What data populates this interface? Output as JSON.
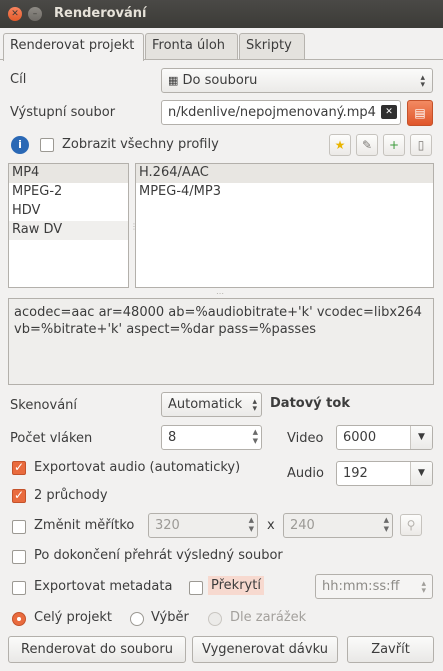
{
  "window": {
    "title": "Renderování"
  },
  "tabs": [
    {
      "label": "Renderovat projekt",
      "active": true
    },
    {
      "label": "Fronta úloh"
    },
    {
      "label": "Skripty"
    }
  ],
  "target": {
    "label": "Cíl",
    "value": "Do souboru"
  },
  "output_file": {
    "label": "Výstupní soubor",
    "value": "n/kdenlive/nepojmenovaný.mp4"
  },
  "show_all_profiles": {
    "label": "Zobrazit všechny profily",
    "checked": false
  },
  "formats": [
    "MP4",
    "MPEG-2",
    "HDV",
    "Raw DV"
  ],
  "codecs": [
    "H.264/AAC",
    "MPEG-4/MP3"
  ],
  "params_text": "acodec=aac ar=48000 ab=%audiobitrate+'k' vcodec=libx264 vb=%bitrate+'k' aspect=%dar pass=%passes",
  "scanning": {
    "label": "Skenování",
    "value": "Automatick"
  },
  "bitrate": {
    "heading": "Datový tok",
    "video_label": "Video",
    "video_value": "6000",
    "audio_label": "Audio",
    "audio_value": "192"
  },
  "threads": {
    "label": "Počet vláken",
    "value": "8"
  },
  "export_audio": {
    "label": "Exportovat audio (automaticky)",
    "checked": true
  },
  "two_pass": {
    "label": "2 průchody",
    "checked": true
  },
  "rescale": {
    "label": "Změnit měřítko",
    "checked": false,
    "width": "320",
    "x": "x",
    "height": "240"
  },
  "play_after": {
    "label": "Po dokončení přehrát výsledný soubor",
    "checked": false
  },
  "export_metadata": {
    "label": "Exportovat metadata",
    "checked": false
  },
  "overlay": {
    "label": "Překrytí",
    "checked": false,
    "timecode": "hh:mm:ss:ff"
  },
  "range": {
    "whole": "Celý projekt",
    "selection": "Výběr",
    "guides": "Dle zarážek",
    "selected": "whole"
  },
  "buttons": {
    "render": "Renderovat do souboru",
    "batch": "Vygenerovat dávku",
    "close": "Zavřít"
  },
  "colors": {
    "accent": "#e96b3e",
    "titlebar": "#3c3b37",
    "window_bg": "#f2f1f0"
  }
}
